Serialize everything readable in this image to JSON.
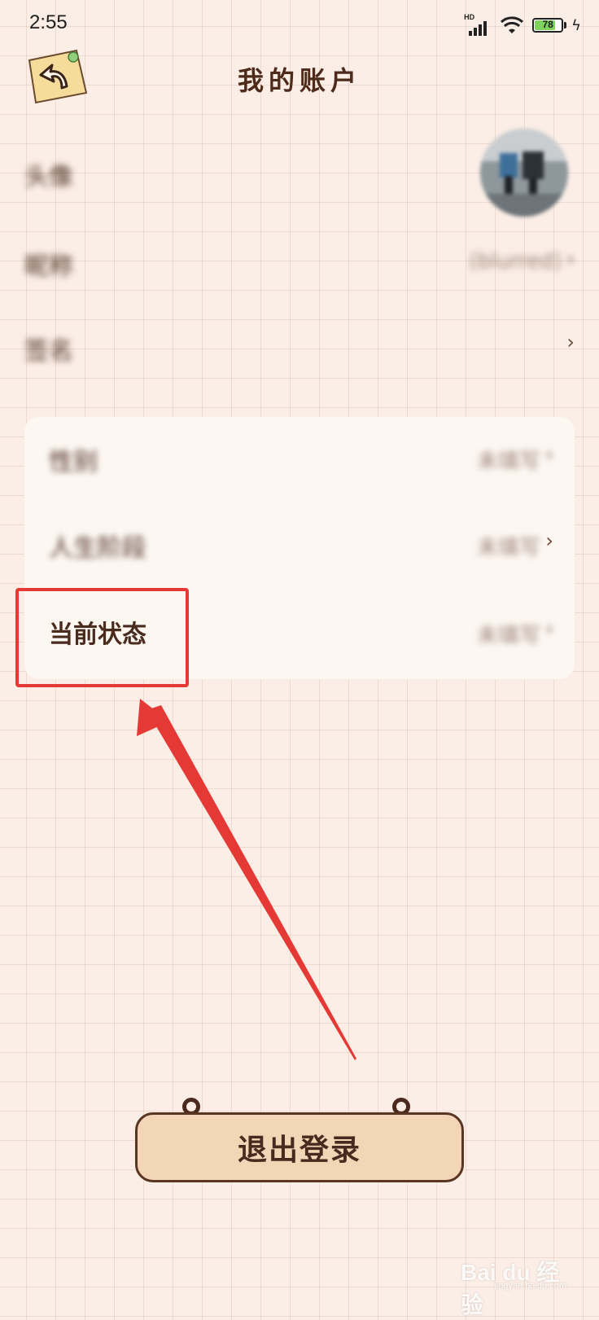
{
  "status_bar": {
    "time": "2:55",
    "network_label": "HD",
    "battery_percent": "78",
    "battery_level": 0.78
  },
  "header": {
    "title": "我的账户",
    "back_icon": "back-arrow-note-icon"
  },
  "profile": {
    "avatar_label": "头像",
    "nickname_label": "昵称",
    "nickname_value": "(blurred)",
    "signature_label": "签名"
  },
  "details": {
    "gender_label": "性别",
    "gender_value": "未填写",
    "birthday_label": "人生阶段",
    "birthday_value": "未填写",
    "status_label": "当前状态",
    "status_value": "未填写"
  },
  "logout": {
    "label": "退出登录"
  },
  "watermark": {
    "brand": "Bai du 经验",
    "sub": "jingyan.baidu.com"
  },
  "colors": {
    "background": "#fbeee6",
    "card": "#fdf7f2",
    "accent_text": "#4e2a1a",
    "logout_bg": "#f3d6b5",
    "highlight": "#e53935"
  }
}
